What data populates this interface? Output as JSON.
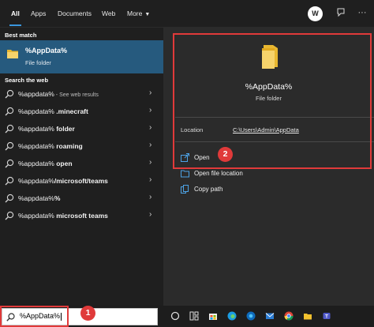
{
  "tabs": [
    {
      "label": "All",
      "active": true
    },
    {
      "label": "Apps"
    },
    {
      "label": "Documents"
    },
    {
      "label": "Web"
    },
    {
      "label": "More"
    }
  ],
  "user_initial": "W",
  "left": {
    "best_match_heading": "Best match",
    "best_match": {
      "title": "%AppData%",
      "subtitle": "File folder",
      "icon": "folder-icon"
    },
    "web_heading": "Search the web",
    "web_results": [
      {
        "bold": "%appdata%",
        "rest": "",
        "note": " - See web results"
      },
      {
        "bold": "%appdata%",
        "rest": " .minecraft",
        "note": ""
      },
      {
        "bold": "%appdata%",
        "rest": " folder",
        "note": ""
      },
      {
        "bold": "%appdata%",
        "rest": " roaming",
        "note": ""
      },
      {
        "bold": "%appdata%",
        "rest": " open",
        "note": ""
      },
      {
        "bold": "%appdata%",
        "rest": "/microsoft/teams",
        "note": ""
      },
      {
        "bold": "%appdata%",
        "rest": "%",
        "note": ""
      },
      {
        "bold": "%appdata%",
        "rest": " microsoft teams",
        "note": ""
      }
    ]
  },
  "right": {
    "title": "%AppData%",
    "subtitle": "File folder",
    "location_label": "Location",
    "location_value": "C:\\Users\\Admin\\AppData",
    "actions": [
      {
        "label": "Open",
        "icon": "open-icon"
      },
      {
        "label": "Open file location",
        "icon": "file-location-icon"
      },
      {
        "label": "Copy path",
        "icon": "copy-icon"
      }
    ]
  },
  "annotations": {
    "badge_1": "1",
    "badge_2": "2",
    "highlight_color": "#e03a3a"
  },
  "taskbar": {
    "search_value": "%AppData%",
    "icons": [
      "task-view-icon",
      "widgets-icon",
      "edge-icon",
      "store-icon",
      "edge-beta-icon",
      "mail-icon",
      "file-explorer-icon",
      "chrome-icon",
      "teams-icon"
    ]
  },
  "colors": {
    "accent": "#3a96dd",
    "selection": "#265a7e",
    "panel": "#2b2b2b",
    "background": "#1f1f1f"
  }
}
